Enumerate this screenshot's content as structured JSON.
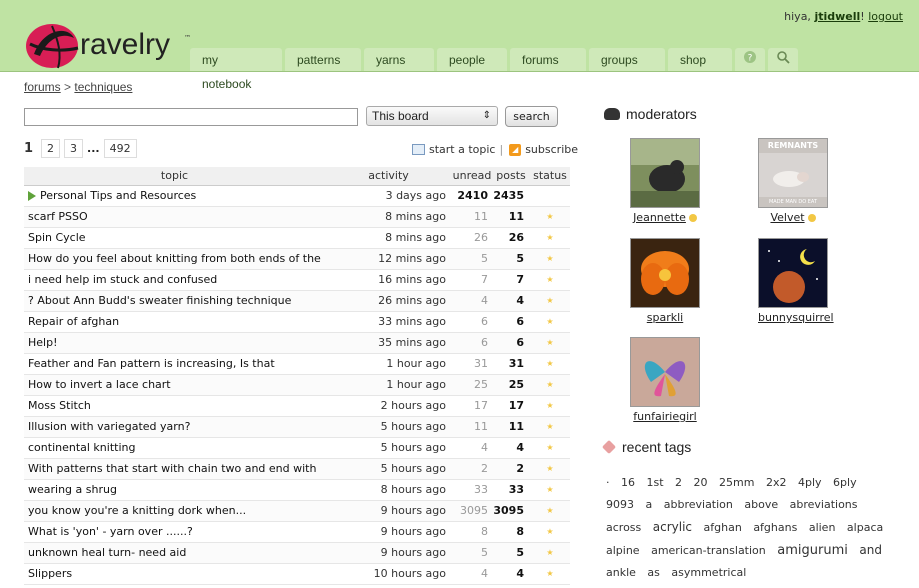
{
  "header": {
    "greeting": "hiya,",
    "username": "jtidwell",
    "exclaim": "!",
    "logout": "logout",
    "logo_text": "ravelry",
    "logo_tm": "™",
    "nav": [
      "my notebook",
      "patterns",
      "yarns",
      "people",
      "forums",
      "groups",
      "shop"
    ],
    "nav_icons": [
      "help-icon",
      "search-icon"
    ]
  },
  "breadcrumb": {
    "root": "forums",
    "sep": ">",
    "current": "techniques"
  },
  "search": {
    "value": "",
    "scope": "This board",
    "button": "search"
  },
  "pager": {
    "current": "1",
    "pages": [
      "2",
      "3"
    ],
    "dots": "...",
    "last": "492"
  },
  "actions": {
    "start": "start a topic",
    "sep": "|",
    "subscribe": "subscribe"
  },
  "table": {
    "headers": {
      "topic": "topic",
      "activity": "activity",
      "unread": "unread",
      "posts": "posts",
      "status": "status"
    },
    "rows": [
      {
        "topic": "Personal Tips and Resources",
        "activity": "3 days ago",
        "unread": "2410",
        "posts": "2435",
        "status": "",
        "pinned": true
      },
      {
        "topic": "scarf PSSO",
        "activity": "8 mins ago",
        "unread": "11",
        "posts": "11",
        "status": "★"
      },
      {
        "topic": "Spin Cycle",
        "activity": "8 mins ago",
        "unread": "26",
        "posts": "26",
        "status": "★"
      },
      {
        "topic": "How do you feel about knitting from both ends of the",
        "activity": "12 mins ago",
        "unread": "5",
        "posts": "5",
        "status": "★"
      },
      {
        "topic": "i need help im stuck and confused",
        "activity": "16 mins ago",
        "unread": "7",
        "posts": "7",
        "status": "★"
      },
      {
        "topic": "? About Ann Budd's sweater finishing technique",
        "activity": "26 mins ago",
        "unread": "4",
        "posts": "4",
        "status": "★"
      },
      {
        "topic": "Repair of afghan",
        "activity": "33 mins ago",
        "unread": "6",
        "posts": "6",
        "status": "★"
      },
      {
        "topic": "Help!",
        "activity": "35 mins ago",
        "unread": "6",
        "posts": "6",
        "status": "★"
      },
      {
        "topic": "Feather and Fan pattern is increasing, Is that",
        "activity": "1 hour ago",
        "unread": "31",
        "posts": "31",
        "status": "★"
      },
      {
        "topic": "How to invert a lace chart",
        "activity": "1 hour ago",
        "unread": "25",
        "posts": "25",
        "status": "★"
      },
      {
        "topic": "Moss Stitch",
        "activity": "2 hours ago",
        "unread": "17",
        "posts": "17",
        "status": "★"
      },
      {
        "topic": "Illusion with variegated yarn?",
        "activity": "5 hours ago",
        "unread": "11",
        "posts": "11",
        "status": "★"
      },
      {
        "topic": "continental knitting",
        "activity": "5 hours ago",
        "unread": "4",
        "posts": "4",
        "status": "★"
      },
      {
        "topic": "With patterns that start with chain two and end with",
        "activity": "5 hours ago",
        "unread": "2",
        "posts": "2",
        "status": "★"
      },
      {
        "topic": "wearing a shrug",
        "activity": "8 hours ago",
        "unread": "33",
        "posts": "33",
        "status": "★"
      },
      {
        "topic": "you know you're a knitting dork when...",
        "activity": "9 hours ago",
        "unread": "3095",
        "posts": "3095",
        "status": "★"
      },
      {
        "topic": "What is 'yon' - yarn over ......?",
        "activity": "9 hours ago",
        "unread": "8",
        "posts": "8",
        "status": "★"
      },
      {
        "topic": "unknown heal turn- need aid",
        "activity": "9 hours ago",
        "unread": "5",
        "posts": "5",
        "status": "★"
      },
      {
        "topic": "Slippers",
        "activity": "10 hours ago",
        "unread": "4",
        "posts": "4",
        "status": "★"
      }
    ]
  },
  "moderators": {
    "title": "moderators",
    "people": [
      {
        "name": "Jeannette",
        "crown": true
      },
      {
        "name": "Velvet",
        "crown": true,
        "pic_text": "REMNANTS",
        "pic_subtext": "MADE MAN DO EAT"
      },
      {
        "name": "sparkli",
        "crown": false
      },
      {
        "name": "bunnysquirrel",
        "crown": false
      },
      {
        "name": "funfairiegirl",
        "crown": false
      }
    ]
  },
  "tags": {
    "title": "recent tags",
    "items": [
      "·",
      "16",
      "1st",
      "2",
      "20",
      "25mm",
      "2x2",
      "4ply",
      "6ply",
      "9093",
      "a",
      "abbreviation",
      "above",
      "abreviations",
      "across",
      "acrylic",
      "afghan",
      "afghans",
      "alien",
      "alpaca",
      "alpine",
      "american-translation",
      "amigurumi",
      "and",
      "ankle",
      "as",
      "asymmetrical"
    ]
  },
  "colors": {
    "header_bg": "#bfe3a3",
    "accent": "#5fa23a",
    "star": "#f2c744",
    "rss": "#f39a1c"
  }
}
